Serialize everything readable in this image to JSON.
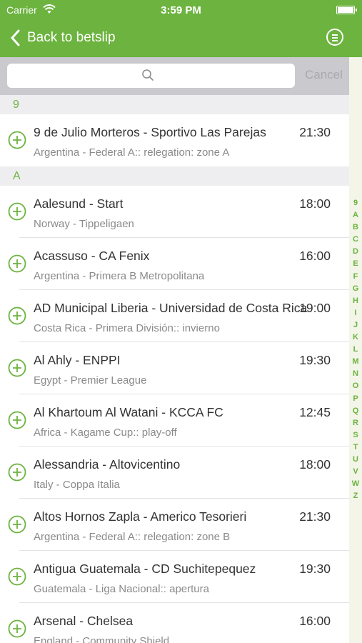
{
  "status_bar": {
    "carrier": "Carrier",
    "time": "3:59 PM"
  },
  "nav": {
    "back_label": "Back to betslip"
  },
  "search": {
    "placeholder": "",
    "cancel_label": "Cancel"
  },
  "sections": [
    {
      "letter": "9",
      "rows": [
        {
          "match": "9 de Julio Morteros - Sportivo Las Parejas",
          "league": "Argentina - Federal A:: relegation: zone A",
          "time": "21:30"
        }
      ]
    },
    {
      "letter": "A",
      "rows": [
        {
          "match": "Aalesund - Start",
          "league": "Norway - Tippeligaen",
          "time": "18:00"
        },
        {
          "match": "Acassuso - CA Fenix",
          "league": "Argentina - Primera B Metropolitana",
          "time": "16:00"
        },
        {
          "match": "AD Municipal Liberia - Universidad de Costa Rica",
          "league": "Costa Rica - Primera División:: invierno",
          "time": "19:00"
        },
        {
          "match": "Al Ahly - ENPPI",
          "league": "Egypt - Premier League",
          "time": "19:30"
        },
        {
          "match": "Al Khartoum Al Watani - KCCA FC",
          "league": "Africa - Kagame Cup:: play-off",
          "time": "12:45"
        },
        {
          "match": "Alessandria - Altovicentino",
          "league": "Italy - Coppa Italia",
          "time": "18:00"
        },
        {
          "match": "Altos Hornos Zapla - Americo Tesorieri",
          "league": "Argentina - Federal A:: relegation: zone B",
          "time": "21:30"
        },
        {
          "match": "Antigua Guatemala - CD Suchitepequez",
          "league": "Guatemala - Liga Nacional:: apertura",
          "time": "19:30"
        },
        {
          "match": "Arsenal - Chelsea",
          "league": "England - Community Shield",
          "time": "16:00"
        }
      ]
    }
  ],
  "index_letters": [
    "9",
    "A",
    "B",
    "C",
    "D",
    "E",
    "F",
    "G",
    "H",
    "I",
    "J",
    "K",
    "L",
    "M",
    "N",
    "O",
    "P",
    "Q",
    "R",
    "S",
    "T",
    "U",
    "V",
    "W",
    "Z"
  ],
  "colors": {
    "accent": "#6cb33f",
    "section_bg": "#eeeef0",
    "index_bg": "#f3f5e8"
  },
  "icons": {
    "back": "chevron-left-icon",
    "menu": "list-circle-icon",
    "search": "search-icon",
    "add": "plus-circle-icon"
  }
}
